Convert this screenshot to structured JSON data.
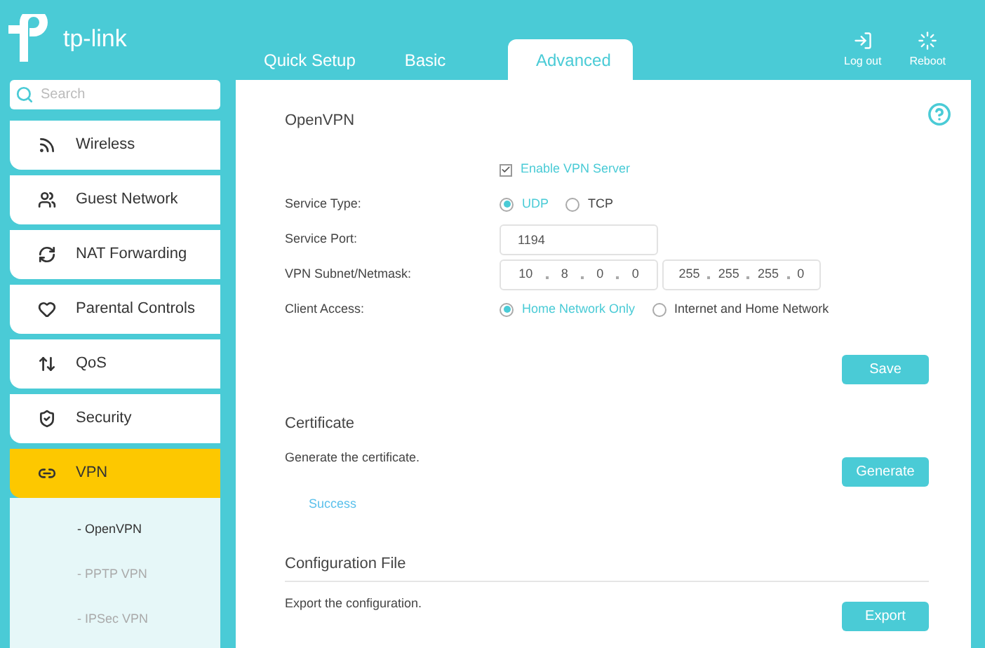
{
  "logo": {
    "text": "tp-link"
  },
  "tabs": [
    {
      "label": "Quick Setup",
      "selected": false
    },
    {
      "label": "Basic",
      "selected": false
    },
    {
      "label": "Advanced",
      "selected": true
    }
  ],
  "header_actions": [
    {
      "kind": "logout",
      "label": "Log out"
    },
    {
      "kind": "reboot",
      "label": "Reboot"
    }
  ],
  "search": {
    "placeholder": "Search"
  },
  "sidebar": {
    "items": [
      {
        "kind": "wireless",
        "label": "Wireless",
        "selected": false
      },
      {
        "kind": "guest",
        "label": "Guest Network",
        "selected": false
      },
      {
        "kind": "nat",
        "label": "NAT Forwarding",
        "selected": false
      },
      {
        "kind": "parental",
        "label": "Parental Controls",
        "selected": false
      },
      {
        "kind": "qos",
        "label": "QoS",
        "selected": false
      },
      {
        "kind": "security",
        "label": "Security",
        "selected": false
      },
      {
        "kind": "vpn",
        "label": "VPN",
        "selected": true,
        "children": [
          {
            "label": "- OpenVPN",
            "selected": true
          },
          {
            "label": "- PPTP VPN",
            "selected": false
          },
          {
            "label": "- IPSec VPN",
            "selected": false
          }
        ]
      }
    ]
  },
  "openvpn": {
    "title": "OpenVPN",
    "enable": {
      "label": "Enable VPN Server",
      "checked": true
    },
    "service_type": {
      "label": "Service Type:",
      "options": [
        {
          "label": "UDP",
          "selected": true
        },
        {
          "label": "TCP",
          "selected": false
        }
      ]
    },
    "service_port": {
      "label": "Service Port:",
      "value": "1194"
    },
    "subnet": {
      "label": "VPN Subnet/Netmask:",
      "ip": [
        "10",
        "8",
        "0",
        "0"
      ],
      "mask": [
        "255",
        "255",
        "255",
        "0"
      ]
    },
    "client_access": {
      "label": "Client Access:",
      "options": [
        {
          "label": "Home Network Only",
          "selected": true
        },
        {
          "label": "Internet and Home Network",
          "selected": false
        }
      ]
    },
    "save": "Save"
  },
  "certificate": {
    "title": "Certificate",
    "text": "Generate the certificate.",
    "button": "Generate",
    "status": "Success"
  },
  "config_file": {
    "title": "Configuration File",
    "text": "Export the configuration.",
    "button": "Export"
  }
}
